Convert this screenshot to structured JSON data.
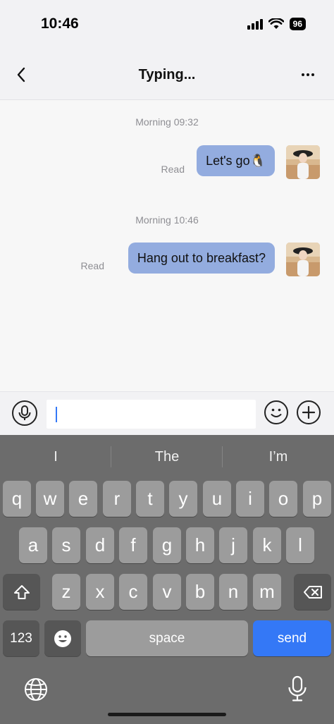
{
  "status_bar": {
    "time": "10:46",
    "battery": "96"
  },
  "nav": {
    "title": "Typing..."
  },
  "chat": {
    "messages": [
      {
        "timestamp": "Morning 09:32",
        "text": "Let's go🐧",
        "status": "Read"
      },
      {
        "timestamp": "Morning 10:46",
        "text": "Hang out to breakfast?",
        "status": "Read"
      }
    ],
    "bubble_color": "#93acdf"
  },
  "input": {
    "value": "",
    "placeholder": ""
  },
  "keyboard": {
    "suggestions": [
      "I",
      "The",
      "I’m"
    ],
    "row1": [
      "q",
      "w",
      "e",
      "r",
      "t",
      "y",
      "u",
      "i",
      "o",
      "p"
    ],
    "row2": [
      "a",
      "s",
      "d",
      "f",
      "g",
      "h",
      "j",
      "k",
      "l"
    ],
    "row3": [
      "z",
      "x",
      "c",
      "v",
      "b",
      "n",
      "m"
    ],
    "numbers_label": "123",
    "space_label": "space",
    "send_label": "send",
    "accent": "#3478f6"
  }
}
